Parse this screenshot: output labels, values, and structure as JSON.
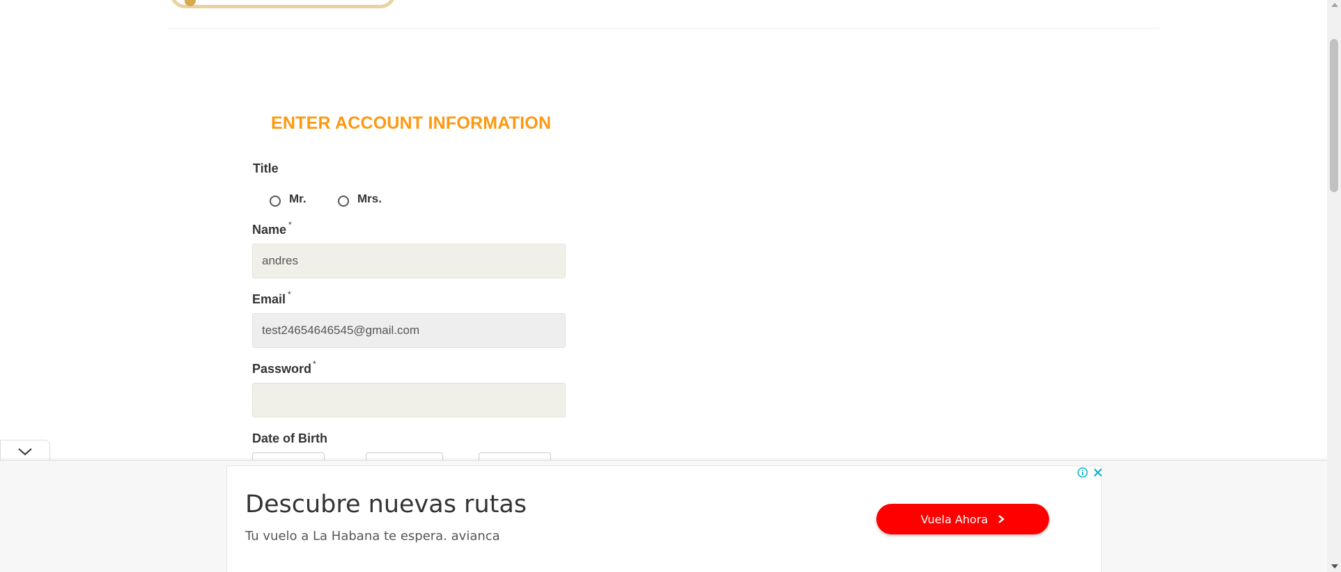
{
  "form": {
    "heading": "ENTER ACCOUNT INFORMATION",
    "title_label": "Title",
    "title_options": [
      "Mr.",
      "Mrs."
    ],
    "name_label": "Name",
    "name_value": "andres",
    "email_label": "Email",
    "email_value": "test24654646545@gmail.com",
    "password_label": "Password",
    "password_value": "",
    "dob_label": "Date of Birth",
    "required_mark": "*"
  },
  "ad": {
    "headline": "Descubre nuevas rutas",
    "subline": "Tu vuelo a La Habana te espera. avianca",
    "cta_label": "Vuela Ahora",
    "cta_color": "#ff0000"
  },
  "colors": {
    "heading": "#fe980f",
    "input_bg": "#f0f0e9"
  },
  "icons": {
    "collapse": "chevron-down-icon",
    "info": "info-icon",
    "close": "close-icon",
    "cta": "chevron-right-icon"
  }
}
